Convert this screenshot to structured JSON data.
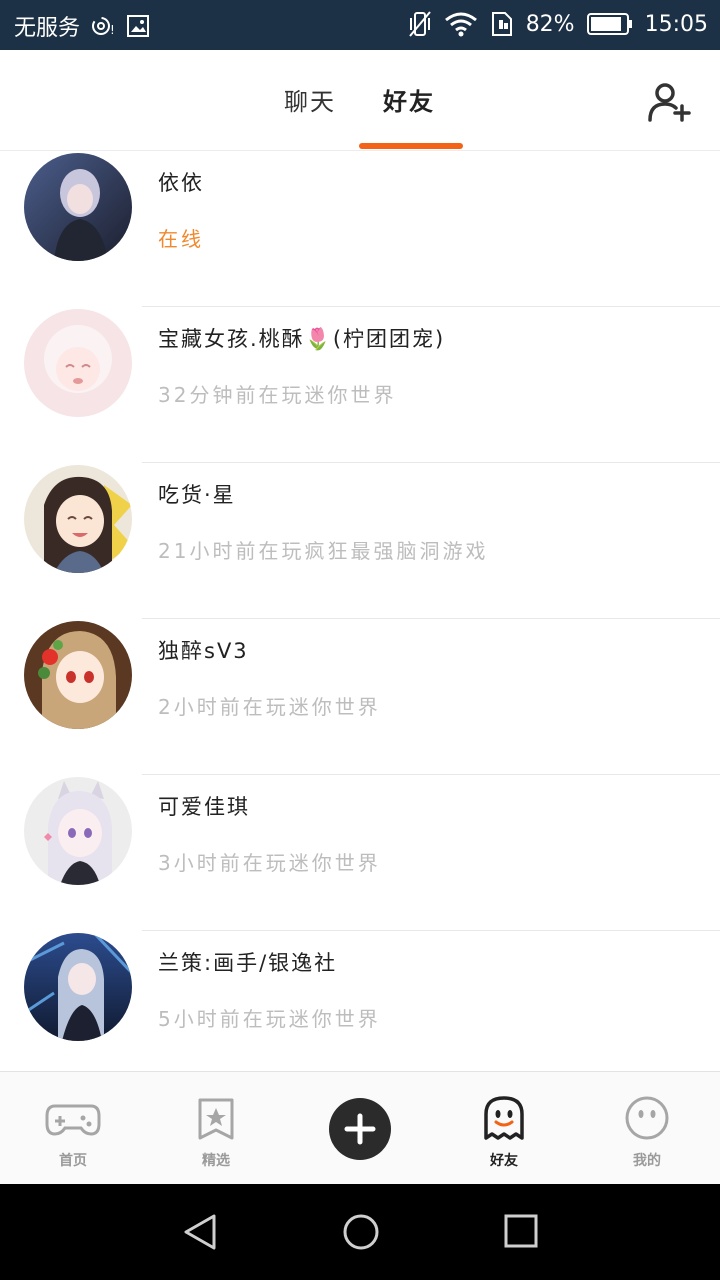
{
  "statusbar": {
    "carrier": "无服务",
    "battery": "82%",
    "time": "15:05"
  },
  "tabs": {
    "chat": "聊天",
    "friends": "好友"
  },
  "friends": [
    {
      "name": "依依",
      "status": "在线",
      "online": true
    },
    {
      "name": "宝藏女孩.桃酥🌷(柠团团宠)",
      "status": "32分钟前在玩迷你世界",
      "online": false
    },
    {
      "name": "吃货·星",
      "status": "21小时前在玩疯狂最强脑洞游戏",
      "online": false
    },
    {
      "name": "独醉sV3",
      "status": "2小时前在玩迷你世界",
      "online": false
    },
    {
      "name": "可爱佳琪",
      "status": "3小时前在玩迷你世界",
      "online": false
    },
    {
      "name": "兰策:画手/银逸社",
      "status": "5小时前在玩迷你世界",
      "online": false
    }
  ],
  "bottom_nav": {
    "home": "首页",
    "featured": "精选",
    "friends": "好友",
    "mine": "我的"
  },
  "colors": {
    "accent": "#f26317",
    "online": "#f0892d",
    "statusbar": "#1d3146"
  }
}
